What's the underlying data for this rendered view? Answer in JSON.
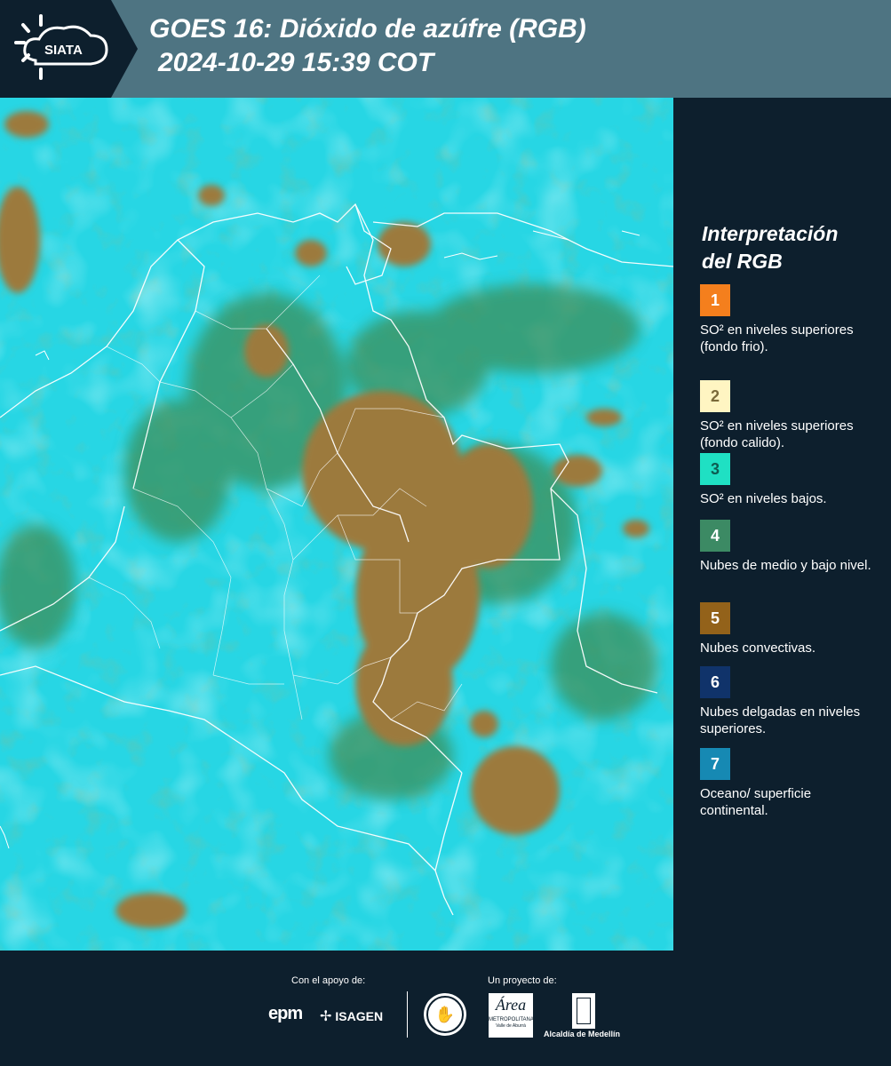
{
  "header": {
    "logo_text": "SIATA",
    "title_line1": "GOES 16: Dióxido de azúfre (RGB)",
    "title_line2": "2024-10-29 15:39 COT"
  },
  "legend": {
    "title_line1": "Interpretación",
    "title_line2": "del RGB",
    "items": [
      {
        "num": "1",
        "color": "#f47f1d",
        "text": "SO² en niveles superiores (fondo frio)."
      },
      {
        "num": "2",
        "color": "#fff5c2",
        "text": "SO² en niveles superiores (fondo calido)."
      },
      {
        "num": "3",
        "color": "#1fe0c3",
        "text": "SO² en niveles bajos."
      },
      {
        "num": "4",
        "color": "#3c8a64",
        "text": "Nubes de medio y bajo nivel."
      },
      {
        "num": "5",
        "color": "#93621a",
        "text": "Nubes convectivas."
      },
      {
        "num": "6",
        "color": "#10336a",
        "text": "Nubes delgadas en niveles superiores."
      },
      {
        "num": "7",
        "color": "#1689b3",
        "text": "Oceano/ superficie continental."
      }
    ]
  },
  "footer": {
    "support_label": "Con el apoyo de:",
    "project_label": "Un proyecto de:",
    "sponsor1": "epm",
    "sponsor2": "ISAGEN",
    "partner_area": "Área",
    "partner_area_sub": "METROPOLITANA",
    "partner_area_sub2": "Valle de Aburrá",
    "partner_alcaldia": "Alcaldía de Medellín"
  }
}
